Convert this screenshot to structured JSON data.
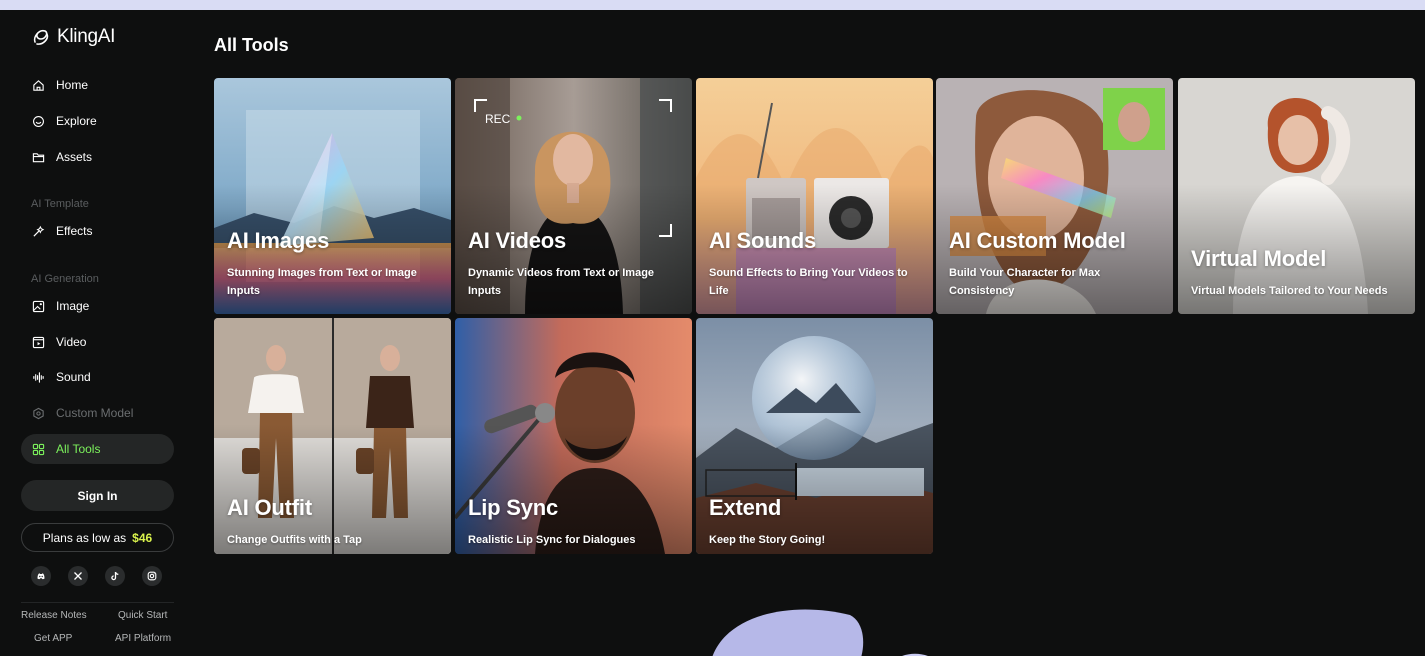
{
  "brand": {
    "name": "KlingAI"
  },
  "nav": {
    "home": "Home",
    "explore": "Explore",
    "assets": "Assets",
    "template_section": "AI Template",
    "effects": "Effects",
    "generation_section": "AI Generation",
    "image": "Image",
    "video": "Video",
    "sound": "Sound",
    "custom_model": "Custom Model",
    "all_tools": "All Tools"
  },
  "sidebar": {
    "sign_in": "Sign In",
    "plans_text": "Plans as low as",
    "plans_price": "$46",
    "socials": [
      "discord-icon",
      "x-icon",
      "tiktok-icon",
      "instagram-icon"
    ],
    "footer": {
      "release_notes": "Release Notes",
      "quick_start": "Quick Start",
      "get_app": "Get APP",
      "api_platform": "API Platform"
    }
  },
  "main": {
    "title": "All Tools",
    "rec_label": "REC",
    "cards": [
      {
        "title": "AI Images",
        "subtitle": "Stunning Images from Text or Image Inputs"
      },
      {
        "title": "AI Videos",
        "subtitle": "Dynamic Videos from Text or Image Inputs"
      },
      {
        "title": "AI Sounds",
        "subtitle": "Sound Effects to Bring Your Videos to Life"
      },
      {
        "title": "AI Custom Model",
        "subtitle": "Build Your Character for Max Consistency"
      },
      {
        "title": "Virtual Model",
        "subtitle": "Virtual Models Tailored to Your Needs"
      },
      {
        "title": "AI Outfit",
        "subtitle": "Change Outfits with a Tap"
      },
      {
        "title": "Lip Sync",
        "subtitle": "Realistic Lip Sync for Dialogues"
      },
      {
        "title": "Extend",
        "subtitle": "Keep the Story Going!"
      }
    ]
  },
  "colors": {
    "background": "#0e0f0f",
    "accent_green": "#7cf25c",
    "price_yellow": "#d9f24c",
    "active_bg": "#242626"
  }
}
